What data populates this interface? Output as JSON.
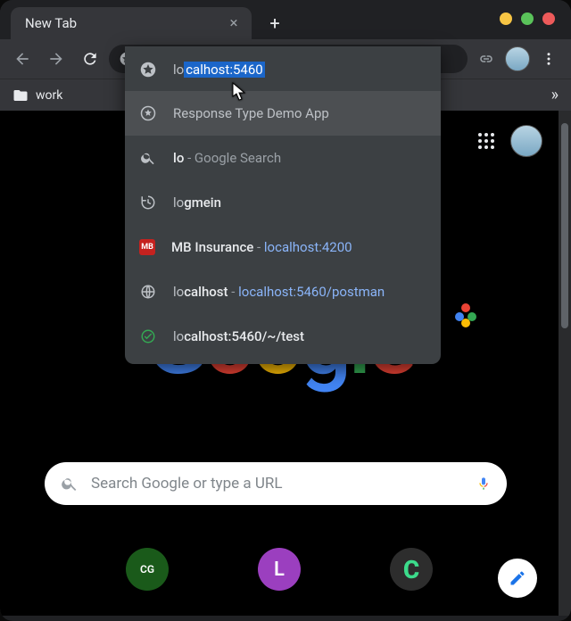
{
  "tab": {
    "title": "New Tab"
  },
  "toolbar": {
    "omnibox": {
      "typed": "lo",
      "completion": "calhost:5460"
    }
  },
  "bookmarks": {
    "folder1": "work"
  },
  "suggestions": [
    {
      "icon": "star-filled",
      "text": "localhost:5460",
      "typed": "lo",
      "rest": "calhost:5460"
    },
    {
      "icon": "star-outline",
      "text": "Response Type Demo App"
    },
    {
      "icon": "search",
      "prefix": "lo",
      "suffix": " - Google Search"
    },
    {
      "icon": "history",
      "prefix": "lo",
      "bold": "gmein"
    },
    {
      "icon": "mb",
      "label": "MB Insurance",
      "sep": " - ",
      "urlpre": "lo",
      "urlrest": "calhost:4200"
    },
    {
      "icon": "globe",
      "prefix": "lo",
      "bold": "calhost",
      "sep": " - ",
      "urlpre": "lo",
      "urlrest": "calhost:5460/postman"
    },
    {
      "icon": "check",
      "prefix": "lo",
      "bold": "calhost:5460/~/test"
    }
  ],
  "ntp": {
    "search_placeholder": "Search Google or type a URL",
    "logo": {
      "g1": "G",
      "o1": "o",
      "o2": "o",
      "g2": "g",
      "l1": "l",
      "e1": "e"
    },
    "shortcuts": {
      "cg": "CG",
      "l": "L",
      "c": "C"
    }
  }
}
